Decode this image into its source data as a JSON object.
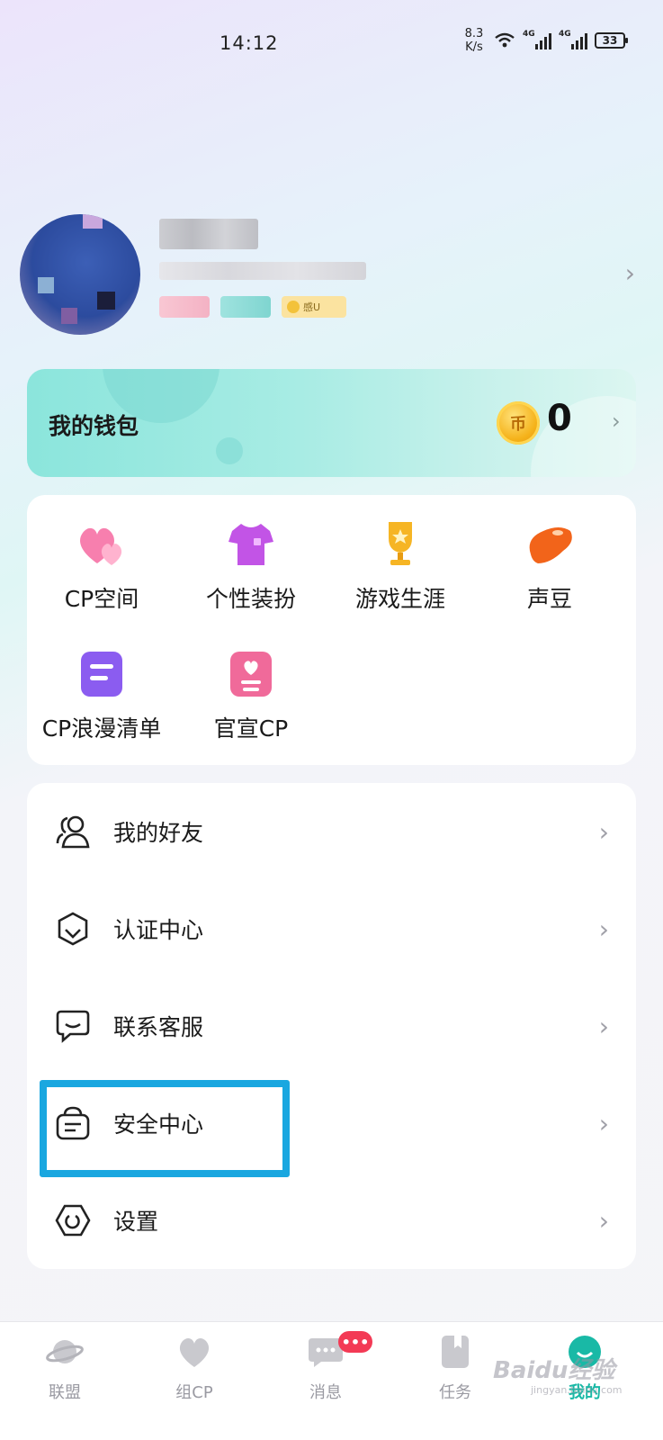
{
  "status_bar": {
    "time": "14:12",
    "speed_value": "8.3",
    "speed_unit": "K/s",
    "net1": "4G",
    "net2": "4G",
    "battery": "33"
  },
  "profile": {
    "tag3_text": "感U"
  },
  "wallet": {
    "title": "我的钱包",
    "coin_icon_text": "币",
    "balance": "0"
  },
  "features": [
    {
      "label": "CP空间",
      "icon": "hearts-icon"
    },
    {
      "label": "个性装扮",
      "icon": "tshirt-icon"
    },
    {
      "label": "游戏生涯",
      "icon": "trophy-icon"
    },
    {
      "label": "声豆",
      "icon": "bean-icon"
    },
    {
      "label": "CP浪漫清单",
      "icon": "list-icon"
    },
    {
      "label": "官宣CP",
      "icon": "heart-card-icon"
    }
  ],
  "menu": [
    {
      "label": "我的好友",
      "icon": "friends-icon"
    },
    {
      "label": "认证中心",
      "icon": "shield-icon"
    },
    {
      "label": "联系客服",
      "icon": "chat-icon"
    },
    {
      "label": "安全中心",
      "icon": "safe-icon"
    },
    {
      "label": "设置",
      "icon": "hexagon-settings-icon"
    }
  ],
  "tabs": [
    {
      "label": "联盟",
      "icon": "planet-icon"
    },
    {
      "label": "组CP",
      "icon": "heart-icon"
    },
    {
      "label": "消息",
      "icon": "message-icon",
      "badge": "•••"
    },
    {
      "label": "任务",
      "icon": "task-icon"
    },
    {
      "label": "我的",
      "icon": "me-icon",
      "active": true
    }
  ],
  "watermark": {
    "text": "Baidu经验",
    "sub": "jingyan.baidu.com"
  },
  "colors": {
    "accent": "#19b9a6",
    "highlight": "#1aa7e0",
    "badge": "#f33a55"
  }
}
